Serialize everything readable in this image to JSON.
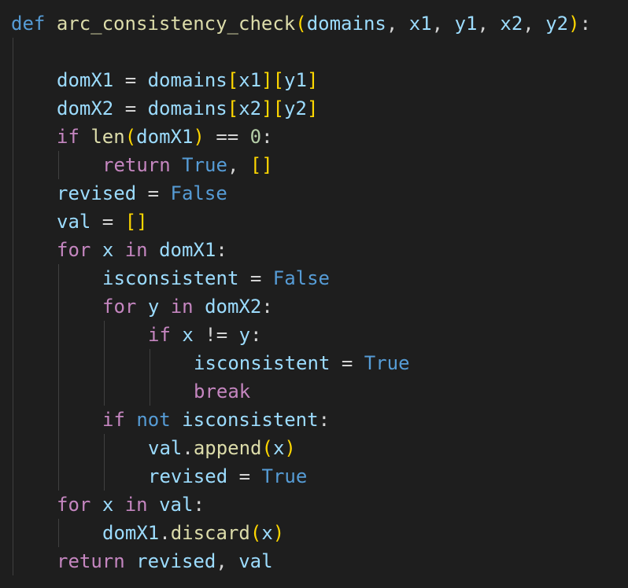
{
  "editor": {
    "language": "python",
    "theme_background": "#1e1e1e",
    "lines": [
      {
        "indent": 0,
        "tokens": [
          {
            "t": "def",
            "c": "kw-def"
          },
          {
            "t": " ",
            "c": "plain"
          },
          {
            "t": "arc_consistency_check",
            "c": "fn"
          },
          {
            "t": "(",
            "c": "paren"
          },
          {
            "t": "domains",
            "c": "param"
          },
          {
            "t": ", ",
            "c": "plain"
          },
          {
            "t": "x1",
            "c": "param"
          },
          {
            "t": ", ",
            "c": "plain"
          },
          {
            "t": "y1",
            "c": "param"
          },
          {
            "t": ", ",
            "c": "plain"
          },
          {
            "t": "x2",
            "c": "param"
          },
          {
            "t": ", ",
            "c": "plain"
          },
          {
            "t": "y2",
            "c": "param"
          },
          {
            "t": ")",
            "c": "paren"
          },
          {
            "t": ":",
            "c": "plain"
          }
        ]
      },
      {
        "indent": 0,
        "tokens": []
      },
      {
        "indent": 1,
        "tokens": [
          {
            "t": "domX1",
            "c": "var"
          },
          {
            "t": " = ",
            "c": "plain"
          },
          {
            "t": "domains",
            "c": "var"
          },
          {
            "t": "[",
            "c": "bracket"
          },
          {
            "t": "x1",
            "c": "var"
          },
          {
            "t": "]",
            "c": "bracket"
          },
          {
            "t": "[",
            "c": "bracket"
          },
          {
            "t": "y1",
            "c": "var"
          },
          {
            "t": "]",
            "c": "bracket"
          }
        ]
      },
      {
        "indent": 1,
        "tokens": [
          {
            "t": "domX2",
            "c": "var"
          },
          {
            "t": " = ",
            "c": "plain"
          },
          {
            "t": "domains",
            "c": "var"
          },
          {
            "t": "[",
            "c": "bracket"
          },
          {
            "t": "x2",
            "c": "var"
          },
          {
            "t": "]",
            "c": "bracket"
          },
          {
            "t": "[",
            "c": "bracket"
          },
          {
            "t": "y2",
            "c": "var"
          },
          {
            "t": "]",
            "c": "bracket"
          }
        ]
      },
      {
        "indent": 1,
        "tokens": [
          {
            "t": "if",
            "c": "ctrl"
          },
          {
            "t": " ",
            "c": "plain"
          },
          {
            "t": "len",
            "c": "fn"
          },
          {
            "t": "(",
            "c": "paren"
          },
          {
            "t": "domX1",
            "c": "var"
          },
          {
            "t": ")",
            "c": "paren"
          },
          {
            "t": " == ",
            "c": "plain"
          },
          {
            "t": "0",
            "c": "num"
          },
          {
            "t": ":",
            "c": "plain"
          }
        ]
      },
      {
        "indent": 2,
        "tokens": [
          {
            "t": "return",
            "c": "ctrl"
          },
          {
            "t": " ",
            "c": "plain"
          },
          {
            "t": "True",
            "c": "const"
          },
          {
            "t": ", ",
            "c": "plain"
          },
          {
            "t": "[]",
            "c": "bracket"
          }
        ]
      },
      {
        "indent": 1,
        "tokens": [
          {
            "t": "revised",
            "c": "var"
          },
          {
            "t": " = ",
            "c": "plain"
          },
          {
            "t": "False",
            "c": "const"
          }
        ]
      },
      {
        "indent": 1,
        "tokens": [
          {
            "t": "val",
            "c": "var"
          },
          {
            "t": " = ",
            "c": "plain"
          },
          {
            "t": "[]",
            "c": "bracket"
          }
        ]
      },
      {
        "indent": 1,
        "tokens": [
          {
            "t": "for",
            "c": "ctrl"
          },
          {
            "t": " ",
            "c": "plain"
          },
          {
            "t": "x",
            "c": "var"
          },
          {
            "t": " ",
            "c": "plain"
          },
          {
            "t": "in",
            "c": "ctrl"
          },
          {
            "t": " ",
            "c": "plain"
          },
          {
            "t": "domX1",
            "c": "var"
          },
          {
            "t": ":",
            "c": "plain"
          }
        ]
      },
      {
        "indent": 2,
        "tokens": [
          {
            "t": "isconsistent",
            "c": "var"
          },
          {
            "t": " = ",
            "c": "plain"
          },
          {
            "t": "False",
            "c": "const"
          }
        ]
      },
      {
        "indent": 2,
        "tokens": [
          {
            "t": "for",
            "c": "ctrl"
          },
          {
            "t": " ",
            "c": "plain"
          },
          {
            "t": "y",
            "c": "var"
          },
          {
            "t": " ",
            "c": "plain"
          },
          {
            "t": "in",
            "c": "ctrl"
          },
          {
            "t": " ",
            "c": "plain"
          },
          {
            "t": "domX2",
            "c": "var"
          },
          {
            "t": ":",
            "c": "plain"
          }
        ]
      },
      {
        "indent": 3,
        "tokens": [
          {
            "t": "if",
            "c": "ctrl"
          },
          {
            "t": " ",
            "c": "plain"
          },
          {
            "t": "x",
            "c": "var"
          },
          {
            "t": " != ",
            "c": "plain"
          },
          {
            "t": "y",
            "c": "var"
          },
          {
            "t": ":",
            "c": "plain"
          }
        ]
      },
      {
        "indent": 4,
        "tokens": [
          {
            "t": "isconsistent",
            "c": "var"
          },
          {
            "t": " = ",
            "c": "plain"
          },
          {
            "t": "True",
            "c": "const"
          }
        ]
      },
      {
        "indent": 4,
        "tokens": [
          {
            "t": "break",
            "c": "ctrl"
          }
        ]
      },
      {
        "indent": 2,
        "tokens": [
          {
            "t": "if",
            "c": "ctrl"
          },
          {
            "t": " ",
            "c": "plain"
          },
          {
            "t": "not",
            "c": "const"
          },
          {
            "t": " ",
            "c": "plain"
          },
          {
            "t": "isconsistent",
            "c": "var"
          },
          {
            "t": ":",
            "c": "plain"
          }
        ]
      },
      {
        "indent": 3,
        "tokens": [
          {
            "t": "val",
            "c": "var"
          },
          {
            "t": ".",
            "c": "plain"
          },
          {
            "t": "append",
            "c": "fn"
          },
          {
            "t": "(",
            "c": "paren"
          },
          {
            "t": "x",
            "c": "var"
          },
          {
            "t": ")",
            "c": "paren"
          }
        ]
      },
      {
        "indent": 3,
        "tokens": [
          {
            "t": "revised",
            "c": "var"
          },
          {
            "t": " = ",
            "c": "plain"
          },
          {
            "t": "True",
            "c": "const"
          }
        ]
      },
      {
        "indent": 1,
        "tokens": [
          {
            "t": "for",
            "c": "ctrl"
          },
          {
            "t": " ",
            "c": "plain"
          },
          {
            "t": "x",
            "c": "var"
          },
          {
            "t": " ",
            "c": "plain"
          },
          {
            "t": "in",
            "c": "ctrl"
          },
          {
            "t": " ",
            "c": "plain"
          },
          {
            "t": "val",
            "c": "var"
          },
          {
            "t": ":",
            "c": "plain"
          }
        ]
      },
      {
        "indent": 2,
        "tokens": [
          {
            "t": "domX1",
            "c": "var"
          },
          {
            "t": ".",
            "c": "plain"
          },
          {
            "t": "discard",
            "c": "fn"
          },
          {
            "t": "(",
            "c": "paren"
          },
          {
            "t": "x",
            "c": "var"
          },
          {
            "t": ")",
            "c": "paren"
          }
        ]
      },
      {
        "indent": 1,
        "tokens": [
          {
            "t": "return",
            "c": "ctrl"
          },
          {
            "t": " ",
            "c": "plain"
          },
          {
            "t": "revised",
            "c": "var"
          },
          {
            "t": ", ",
            "c": "plain"
          },
          {
            "t": "val",
            "c": "var"
          }
        ]
      }
    ]
  }
}
